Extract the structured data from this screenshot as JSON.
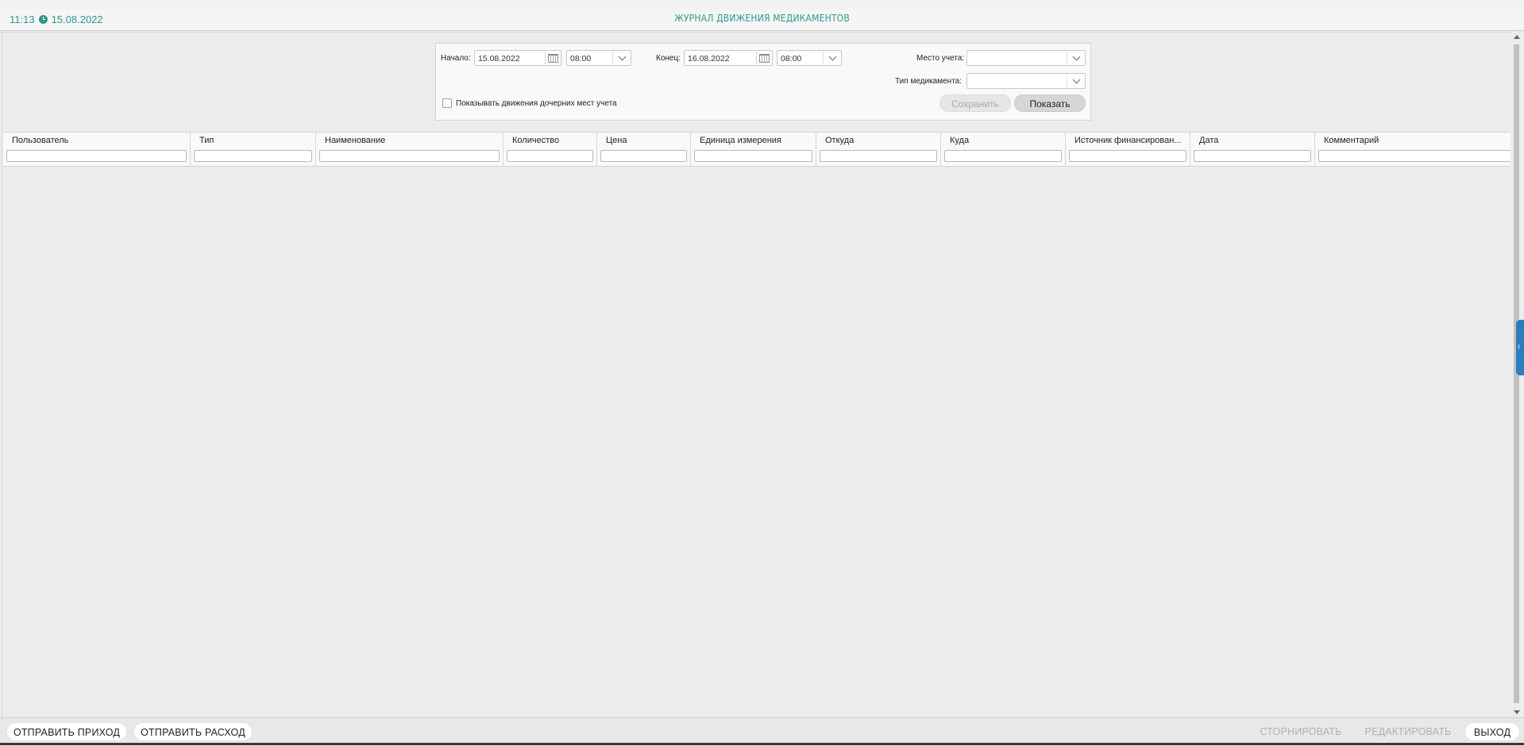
{
  "header": {
    "time": "11:13",
    "date": "15.08.2022",
    "title": "ЖУРНАЛ ДВИЖЕНИЯ МЕДИКАМЕНТОВ"
  },
  "filters": {
    "start_label": "Начало:",
    "start_date": "15.08.2022",
    "start_time": "08:00",
    "end_label": "Конец:",
    "end_date": "16.08.2022",
    "end_time": "08:00",
    "location_label": "Место учета:",
    "location_value": "",
    "med_type_label": "Тип медикамента:",
    "med_type_value": "",
    "child_checkbox_label": "Показывать движения дочерних мест учета",
    "child_checkbox_checked": false,
    "save_label": "Сохранить",
    "show_label": "Показать"
  },
  "table": {
    "columns": [
      "Пользователь",
      "Тип",
      "Наименование",
      "Количество",
      "Цена",
      "Единица измерения",
      "Откуда",
      "Куда",
      "Источник финансирован...",
      "Дата",
      "Комментарий"
    ],
    "rows": []
  },
  "footer": {
    "send_income": "ОТПРАВИТЬ ПРИХОД",
    "send_expense": "ОТПРАВИТЬ РАСХОД",
    "reverse": "СТОРНИРОВАТЬ",
    "edit": "РЕДАКТИРОВАТЬ",
    "exit": "ВЫХОД"
  },
  "colors": {
    "accent": "#2e9a8a",
    "side_tab": "#2a7dbf"
  }
}
